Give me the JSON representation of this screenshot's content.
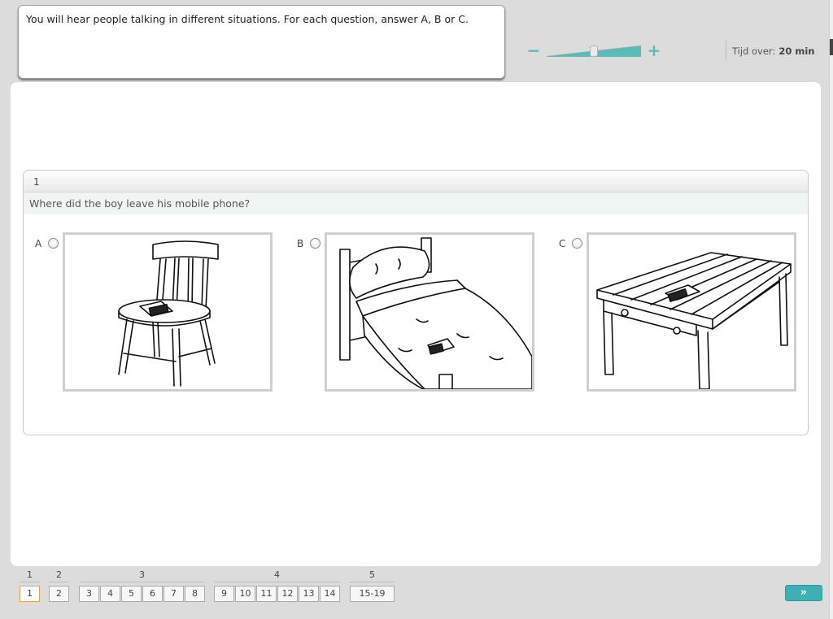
{
  "instructions": "You will hear people talking in different situations. For each question, answer A, B or C.",
  "volume": {
    "level_percent": 57,
    "minus_icon": "minus-icon",
    "plus_icon": "plus-icon"
  },
  "timer": {
    "label": "Tijd over:",
    "value": "20 min"
  },
  "question": {
    "number": "1",
    "text": "Where did the boy leave his mobile phone?",
    "options": [
      {
        "letter": "A",
        "image": "chair-with-phone"
      },
      {
        "letter": "B",
        "image": "bed-with-phone"
      },
      {
        "letter": "C",
        "image": "table-with-phone"
      }
    ]
  },
  "nav": {
    "parts": [
      "1",
      "2",
      "3",
      "4",
      "5"
    ],
    "buttons": [
      "1",
      "2",
      "3",
      "4",
      "5",
      "6",
      "7",
      "8",
      "9",
      "10",
      "11",
      "12",
      "13",
      "14",
      "15-19"
    ],
    "current": "1",
    "next_label": "»",
    "next_icon": "double-chevron-right-icon"
  },
  "colors": {
    "accent": "#3cb1b3",
    "current_outline": "#e6a34c",
    "panel_bg": "#dcdcdc"
  }
}
